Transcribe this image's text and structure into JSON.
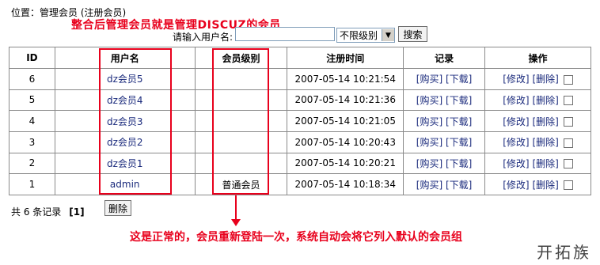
{
  "breadcrumb": "位置：管理会员 (注册会员)",
  "annotations": {
    "top": "整合后管理会员就是管理DISCUZ的会员",
    "bottom": "这是正常的，会员重新登陆一次，系统自动会将它列入默认的会员组"
  },
  "search": {
    "label": "请输入用户名:",
    "value": "",
    "level_selected": "不限级别",
    "button": "搜索"
  },
  "table": {
    "headers": [
      "ID",
      "用户名",
      "会员级别",
      "注册时间",
      "记录",
      "操作"
    ],
    "rows": [
      {
        "id": "6",
        "username": "dz会员5",
        "level": "",
        "time": "2007-05-14 10:21:54",
        "buy": "[购买]",
        "download": "[下载]",
        "edit": "[修改]",
        "delete": "[删除]"
      },
      {
        "id": "5",
        "username": "dz会员4",
        "level": "",
        "time": "2007-05-14 10:21:36",
        "buy": "[购买]",
        "download": "[下载]",
        "edit": "[修改]",
        "delete": "[删除]"
      },
      {
        "id": "4",
        "username": "dz会员3",
        "level": "",
        "time": "2007-05-14 10:21:05",
        "buy": "[购买]",
        "download": "[下载]",
        "edit": "[修改]",
        "delete": "[删除]"
      },
      {
        "id": "3",
        "username": "dz会员2",
        "level": "",
        "time": "2007-05-14 10:20:43",
        "buy": "[购买]",
        "download": "[下载]",
        "edit": "[修改]",
        "delete": "[删除]"
      },
      {
        "id": "2",
        "username": "dz会员1",
        "level": "",
        "time": "2007-05-14 10:20:21",
        "buy": "[购买]",
        "download": "[下载]",
        "edit": "[修改]",
        "delete": "[删除]"
      },
      {
        "id": "1",
        "username": "admin",
        "level": "普通会员",
        "time": "2007-05-14 10:18:34",
        "buy": "[购买]",
        "download": "[下载]",
        "edit": "[修改]",
        "delete": "[删除]"
      }
    ]
  },
  "footer": {
    "total": "共 6 条记录",
    "page": "[1]",
    "delete_button": "删除"
  },
  "watermark": "开拓族",
  "colors": {
    "annotation": "#e8001c",
    "link": "#1a2a7c"
  }
}
